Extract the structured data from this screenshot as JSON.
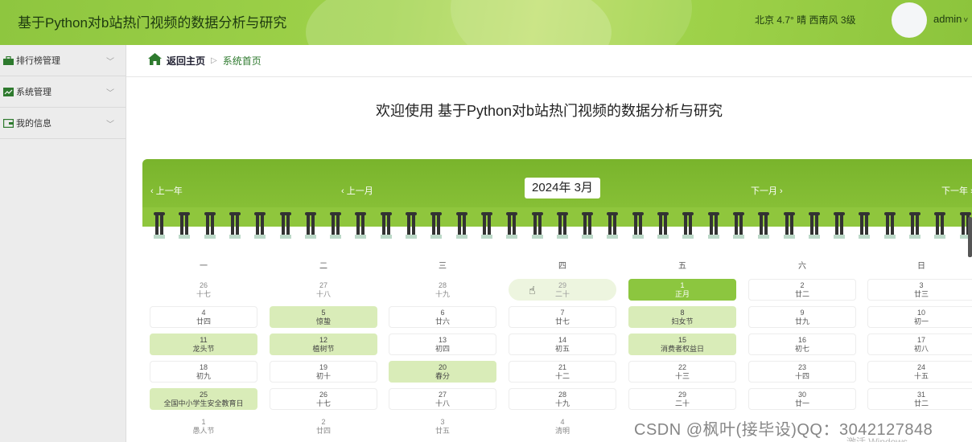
{
  "header": {
    "title": "基于Python对b站热门视频的数据分析与研究",
    "weather": "北京 4.7° 晴 西南风 3级",
    "username": "admin",
    "caret": "˅"
  },
  "sidebar": {
    "items": [
      {
        "label": "排行榜管理",
        "icon": "briefcase-icon"
      },
      {
        "label": "系统管理",
        "icon": "chart-icon"
      },
      {
        "label": "我的信息",
        "icon": "wallet-icon"
      }
    ]
  },
  "breadcrumb": {
    "home": "返回主页",
    "separator": "▷",
    "current": "系统首页"
  },
  "welcome": "欢迎使用 基于Python对b站热门视频的数据分析与研究",
  "calendar": {
    "prev_year": "上一年",
    "prev_month": "上一月",
    "month": "2024年 3月",
    "next_month": "下一月",
    "next_year": "下一年",
    "weekdays": [
      "一",
      "二",
      "三",
      "四",
      "五",
      "六",
      "日"
    ],
    "rows": [
      [
        {
          "n": "26",
          "l": "十七",
          "s": "plain"
        },
        {
          "n": "27",
          "l": "十八",
          "s": "plain"
        },
        {
          "n": "28",
          "l": "十九",
          "s": "plain"
        },
        {
          "n": "29",
          "l": "二十",
          "s": "faint"
        },
        {
          "n": "1",
          "l": "正月",
          "s": "today"
        },
        {
          "n": "2",
          "l": "廿二",
          "s": ""
        },
        {
          "n": "3",
          "l": "廿三",
          "s": ""
        }
      ],
      [
        {
          "n": "4",
          "l": "廿四",
          "s": ""
        },
        {
          "n": "5",
          "l": "惊蛰",
          "s": "hl"
        },
        {
          "n": "6",
          "l": "廿六",
          "s": ""
        },
        {
          "n": "7",
          "l": "廿七",
          "s": ""
        },
        {
          "n": "8",
          "l": "妇女节",
          "s": "hl"
        },
        {
          "n": "9",
          "l": "廿九",
          "s": ""
        },
        {
          "n": "10",
          "l": "初一",
          "s": ""
        }
      ],
      [
        {
          "n": "11",
          "l": "龙头节",
          "s": "hl"
        },
        {
          "n": "12",
          "l": "植树节",
          "s": "hl"
        },
        {
          "n": "13",
          "l": "初四",
          "s": ""
        },
        {
          "n": "14",
          "l": "初五",
          "s": ""
        },
        {
          "n": "15",
          "l": "消费者权益日",
          "s": "hl"
        },
        {
          "n": "16",
          "l": "初七",
          "s": ""
        },
        {
          "n": "17",
          "l": "初八",
          "s": ""
        }
      ],
      [
        {
          "n": "18",
          "l": "初九",
          "s": ""
        },
        {
          "n": "19",
          "l": "初十",
          "s": ""
        },
        {
          "n": "20",
          "l": "春分",
          "s": "hl"
        },
        {
          "n": "21",
          "l": "十二",
          "s": ""
        },
        {
          "n": "22",
          "l": "十三",
          "s": ""
        },
        {
          "n": "23",
          "l": "十四",
          "s": ""
        },
        {
          "n": "24",
          "l": "十五",
          "s": ""
        }
      ],
      [
        {
          "n": "25",
          "l": "全国中小学生安全教育日",
          "s": "hl"
        },
        {
          "n": "26",
          "l": "十七",
          "s": ""
        },
        {
          "n": "27",
          "l": "十八",
          "s": ""
        },
        {
          "n": "28",
          "l": "十九",
          "s": ""
        },
        {
          "n": "29",
          "l": "二十",
          "s": ""
        },
        {
          "n": "30",
          "l": "廿一",
          "s": ""
        },
        {
          "n": "31",
          "l": "廿二",
          "s": ""
        }
      ],
      [
        {
          "n": "1",
          "l": "愚人节",
          "s": "plain"
        },
        {
          "n": "2",
          "l": "廿四",
          "s": "plain"
        },
        {
          "n": "3",
          "l": "廿五",
          "s": "plain"
        },
        {
          "n": "4",
          "l": "清明",
          "s": "plain"
        }
      ]
    ]
  },
  "watermark": "CSDN @枫叶(接毕设)QQ：3042127848",
  "win_watermark": "激活 Windows"
}
